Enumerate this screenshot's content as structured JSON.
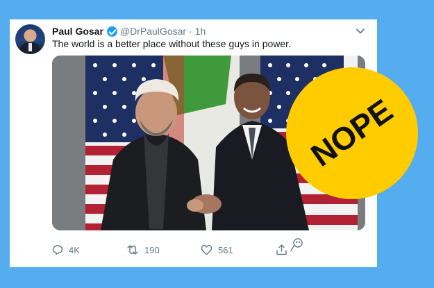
{
  "tweet": {
    "name": "Paul Gosar",
    "handle": "@DrPaulGosar",
    "separator": "·",
    "time": "1h",
    "text": "The world is a better place without these guys in power."
  },
  "actions": {
    "replies": "4K",
    "retweets": "190",
    "likes": "561"
  },
  "badge": {
    "label": "NOPE",
    "color": "#ffcc00"
  },
  "colors": {
    "background": "#55acee",
    "verified": "#1da1f2",
    "meta": "#657786"
  },
  "icons": [
    "verified-badge-icon",
    "chevron-down-icon",
    "reply-icon",
    "retweet-icon",
    "like-icon",
    "share-icon",
    "pin-icon"
  ]
}
